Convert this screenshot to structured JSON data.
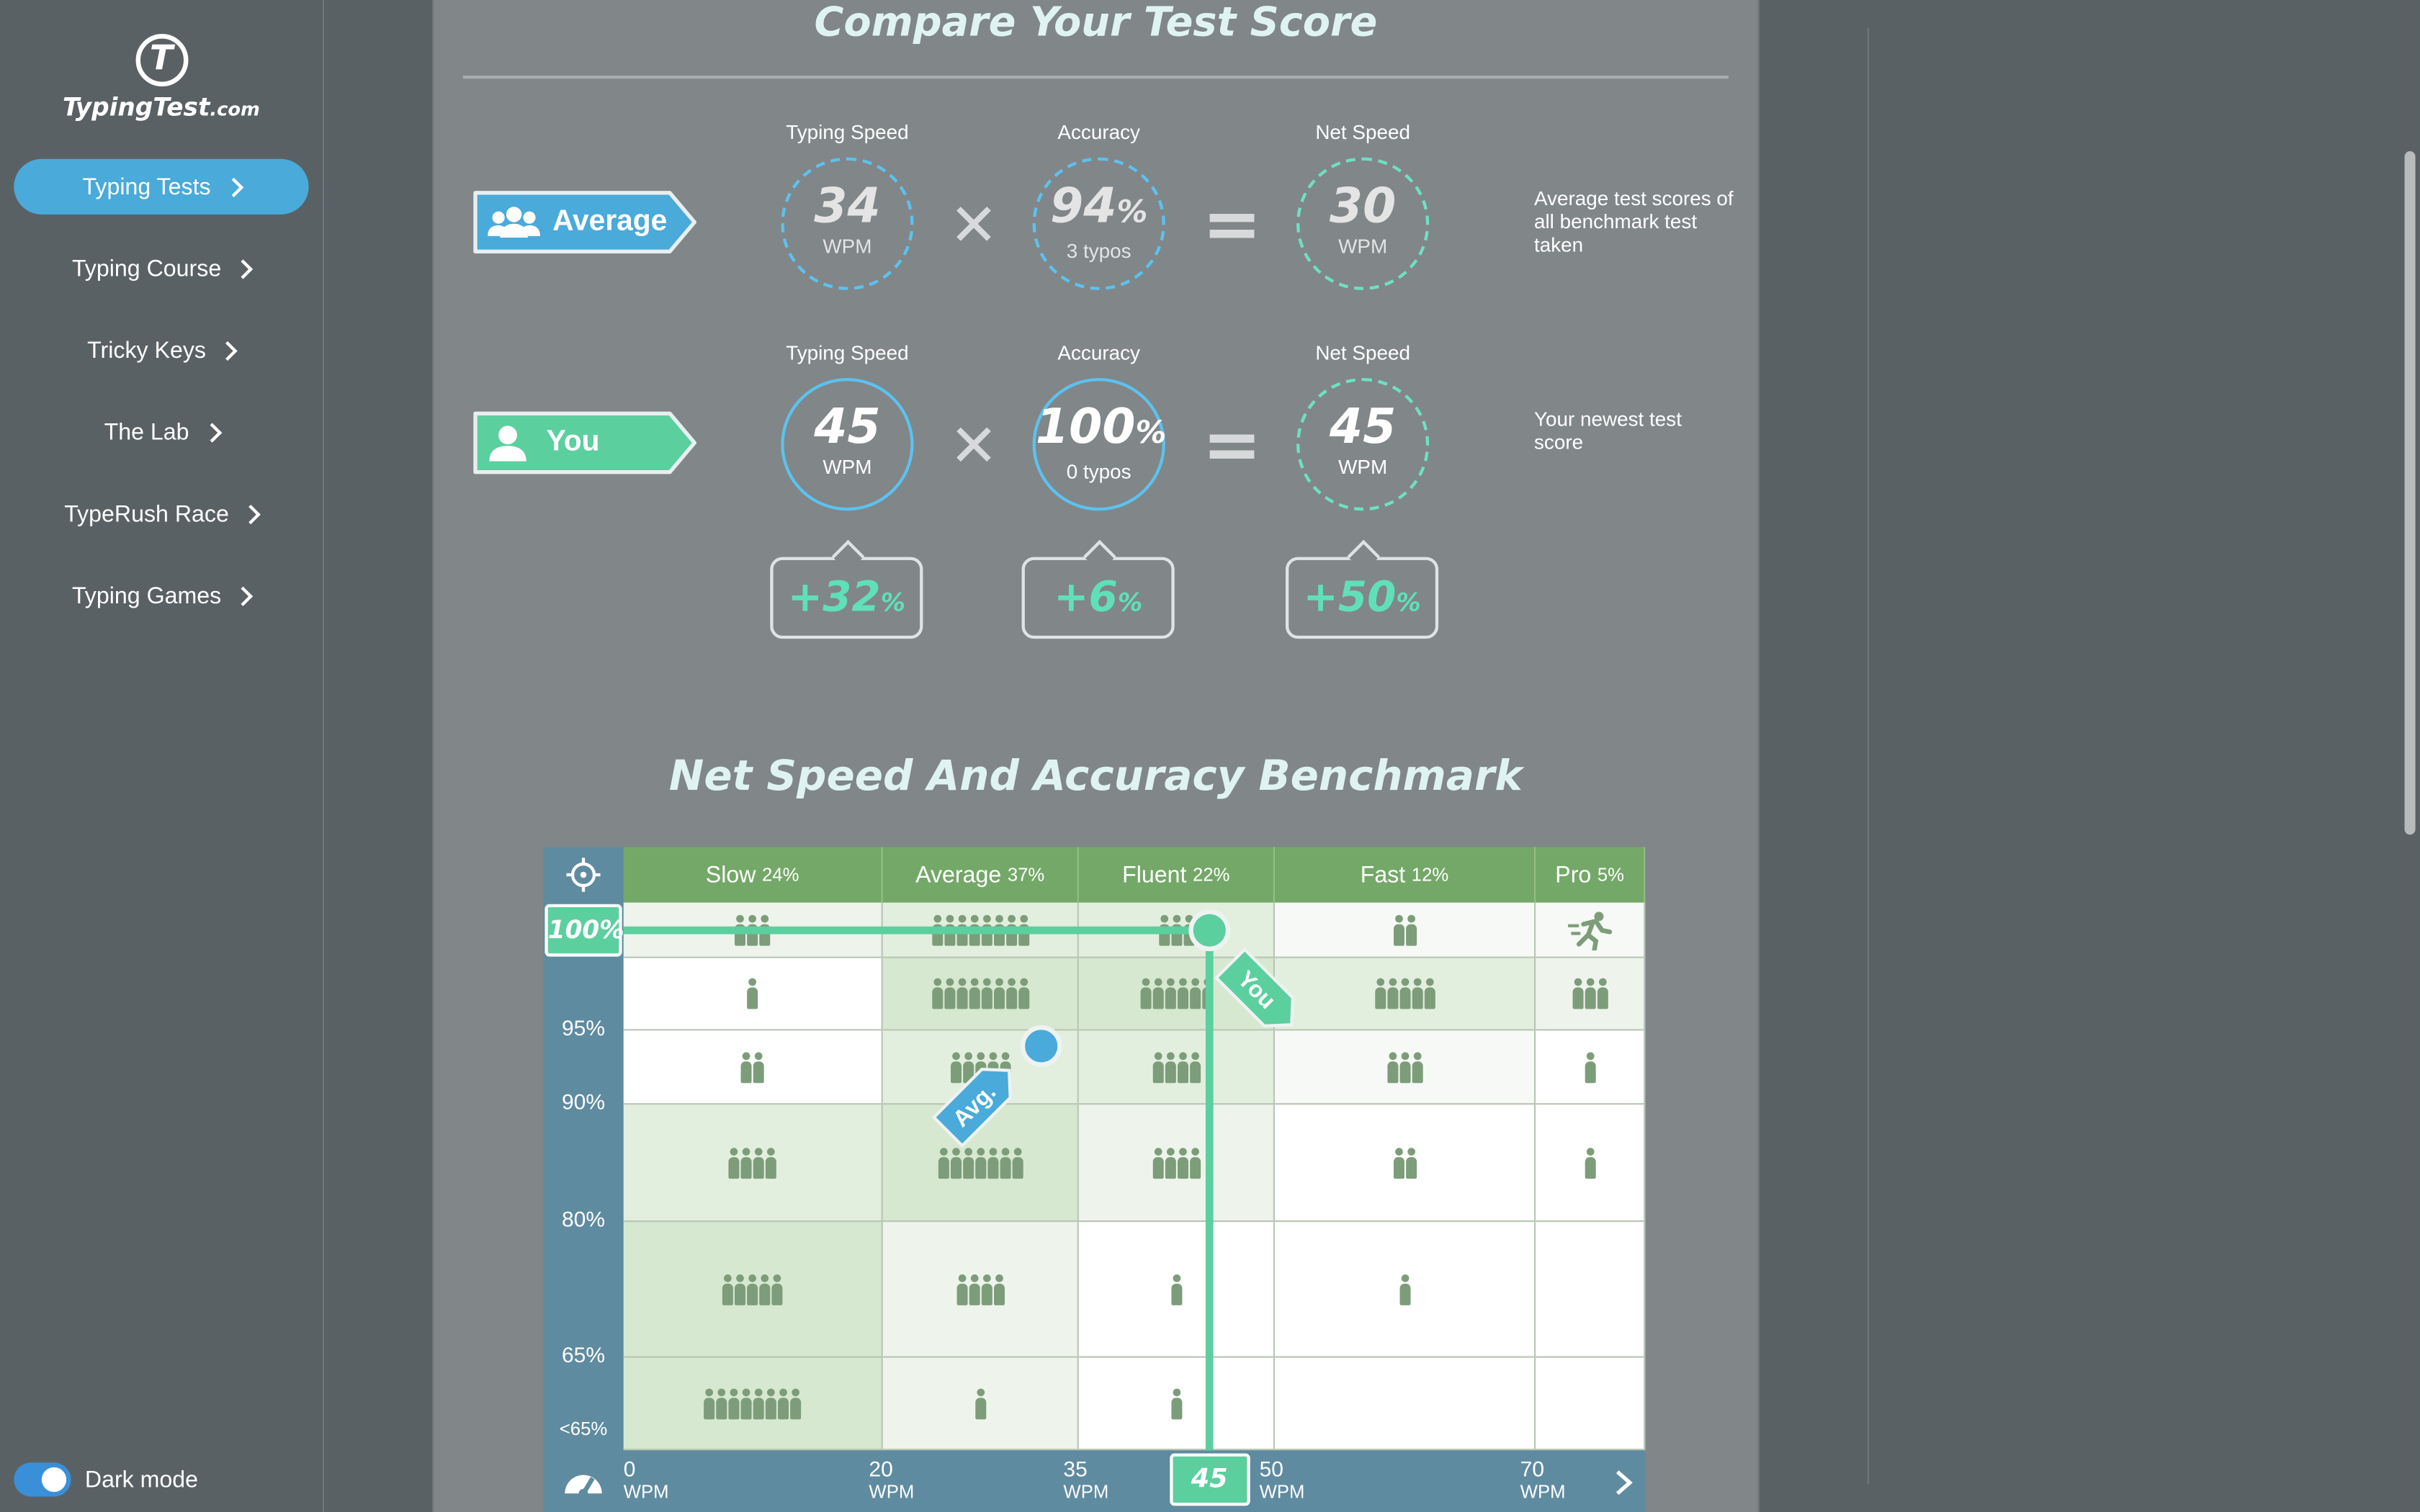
{
  "sidebar": {
    "logo_text": "TypingTest",
    "logo_suffix": ".com",
    "items": [
      {
        "label": "Typing Tests",
        "active": true
      },
      {
        "label": "Typing Course"
      },
      {
        "label": "Tricky Keys"
      },
      {
        "label": "The Lab"
      },
      {
        "label": "TypeRush Race"
      },
      {
        "label": "Typing Games"
      }
    ],
    "dark_mode_label": "Dark mode",
    "dark_mode_on": true
  },
  "compare": {
    "title": "Compare Your Test Score",
    "average": {
      "label": "Average",
      "typing_speed_header": "Typing Speed",
      "accuracy_header": "Accuracy",
      "net_speed_header": "Net Speed",
      "typing_speed": "34",
      "typing_speed_unit": "WPM",
      "accuracy": "94",
      "accuracy_unit": "%",
      "typos": "3 typos",
      "net_speed": "30",
      "net_speed_unit": "WPM",
      "note": "Average test scores of all benchmark test taken"
    },
    "you": {
      "label": "You",
      "typing_speed_header": "Typing Speed",
      "accuracy_header": "Accuracy",
      "net_speed_header": "Net Speed",
      "typing_speed": "45",
      "typing_speed_unit": "WPM",
      "accuracy": "100",
      "accuracy_unit": "%",
      "typos": "0 typos",
      "net_speed": "45",
      "net_speed_unit": "WPM",
      "note": "Your newest test score"
    },
    "deltas": [
      {
        "value": "+32",
        "unit": "%"
      },
      {
        "value": "+6",
        "unit": "%"
      },
      {
        "value": "+50",
        "unit": "%"
      }
    ]
  },
  "benchmark": {
    "title": "Net Speed And Accuracy Benchmark",
    "categories": [
      {
        "name": "Slow",
        "pct": "24%"
      },
      {
        "name": "Average",
        "pct": "37%"
      },
      {
        "name": "Fluent",
        "pct": "22%"
      },
      {
        "name": "Fast",
        "pct": "12%"
      },
      {
        "name": "Pro",
        "pct": "5%"
      }
    ],
    "y_labels": [
      "100%",
      "95%",
      "90%",
      "80%",
      "65%",
      "<65%"
    ],
    "x_ticks": [
      {
        "value": "0",
        "unit": "WPM"
      },
      {
        "value": "20",
        "unit": "WPM"
      },
      {
        "value": "35",
        "unit": "WPM"
      },
      {
        "value": "50",
        "unit": "WPM"
      },
      {
        "value": "70",
        "unit": "WPM"
      }
    ],
    "you_marker": {
      "label": "You",
      "net_speed": "45",
      "accuracy_row": "100%"
    },
    "avg_marker": {
      "label": "Avg.",
      "net_speed": 30,
      "accuracy": 94
    },
    "grid_counts": [
      [
        3,
        8,
        3,
        2,
        0
      ],
      [
        1,
        8,
        6,
        5,
        3
      ],
      [
        2,
        5,
        4,
        3,
        1
      ],
      [
        4,
        7,
        4,
        2,
        1
      ],
      [
        5,
        4,
        1,
        1,
        0
      ],
      [
        8,
        1,
        1,
        0,
        0
      ]
    ],
    "colors": {
      "you": "#5ccf9f",
      "avg": "#4aaad9",
      "header": "#74a868",
      "axis": "#5f8ba0"
    }
  }
}
